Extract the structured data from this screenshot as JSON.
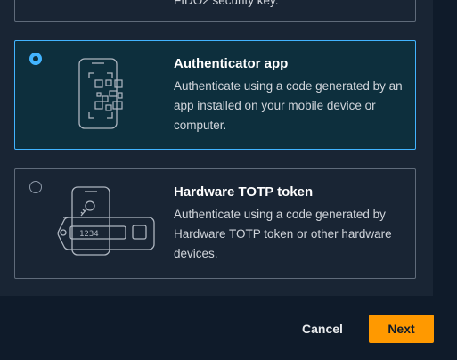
{
  "options": {
    "security_key": {
      "description_partial": "FIDO2 security key."
    },
    "authenticator": {
      "title": "Authenticator app",
      "description": "Authenticate using a code generated by an app installed on your mobile device or computer.",
      "selected": true,
      "icon": "phone-qr-icon"
    },
    "hardware": {
      "title": "Hardware TOTP token",
      "description": "Authenticate using a code generated by Hardware TOTP token or other hardware devices.",
      "selected": false,
      "icon": "totp-token-icon",
      "token_display": "1234"
    }
  },
  "footer": {
    "cancel_label": "Cancel",
    "next_label": "Next"
  },
  "colors": {
    "accent": "#42b4ff",
    "primary_button": "#ff9900",
    "page_background": "#0f1b2a",
    "panel_background": "#192534"
  }
}
